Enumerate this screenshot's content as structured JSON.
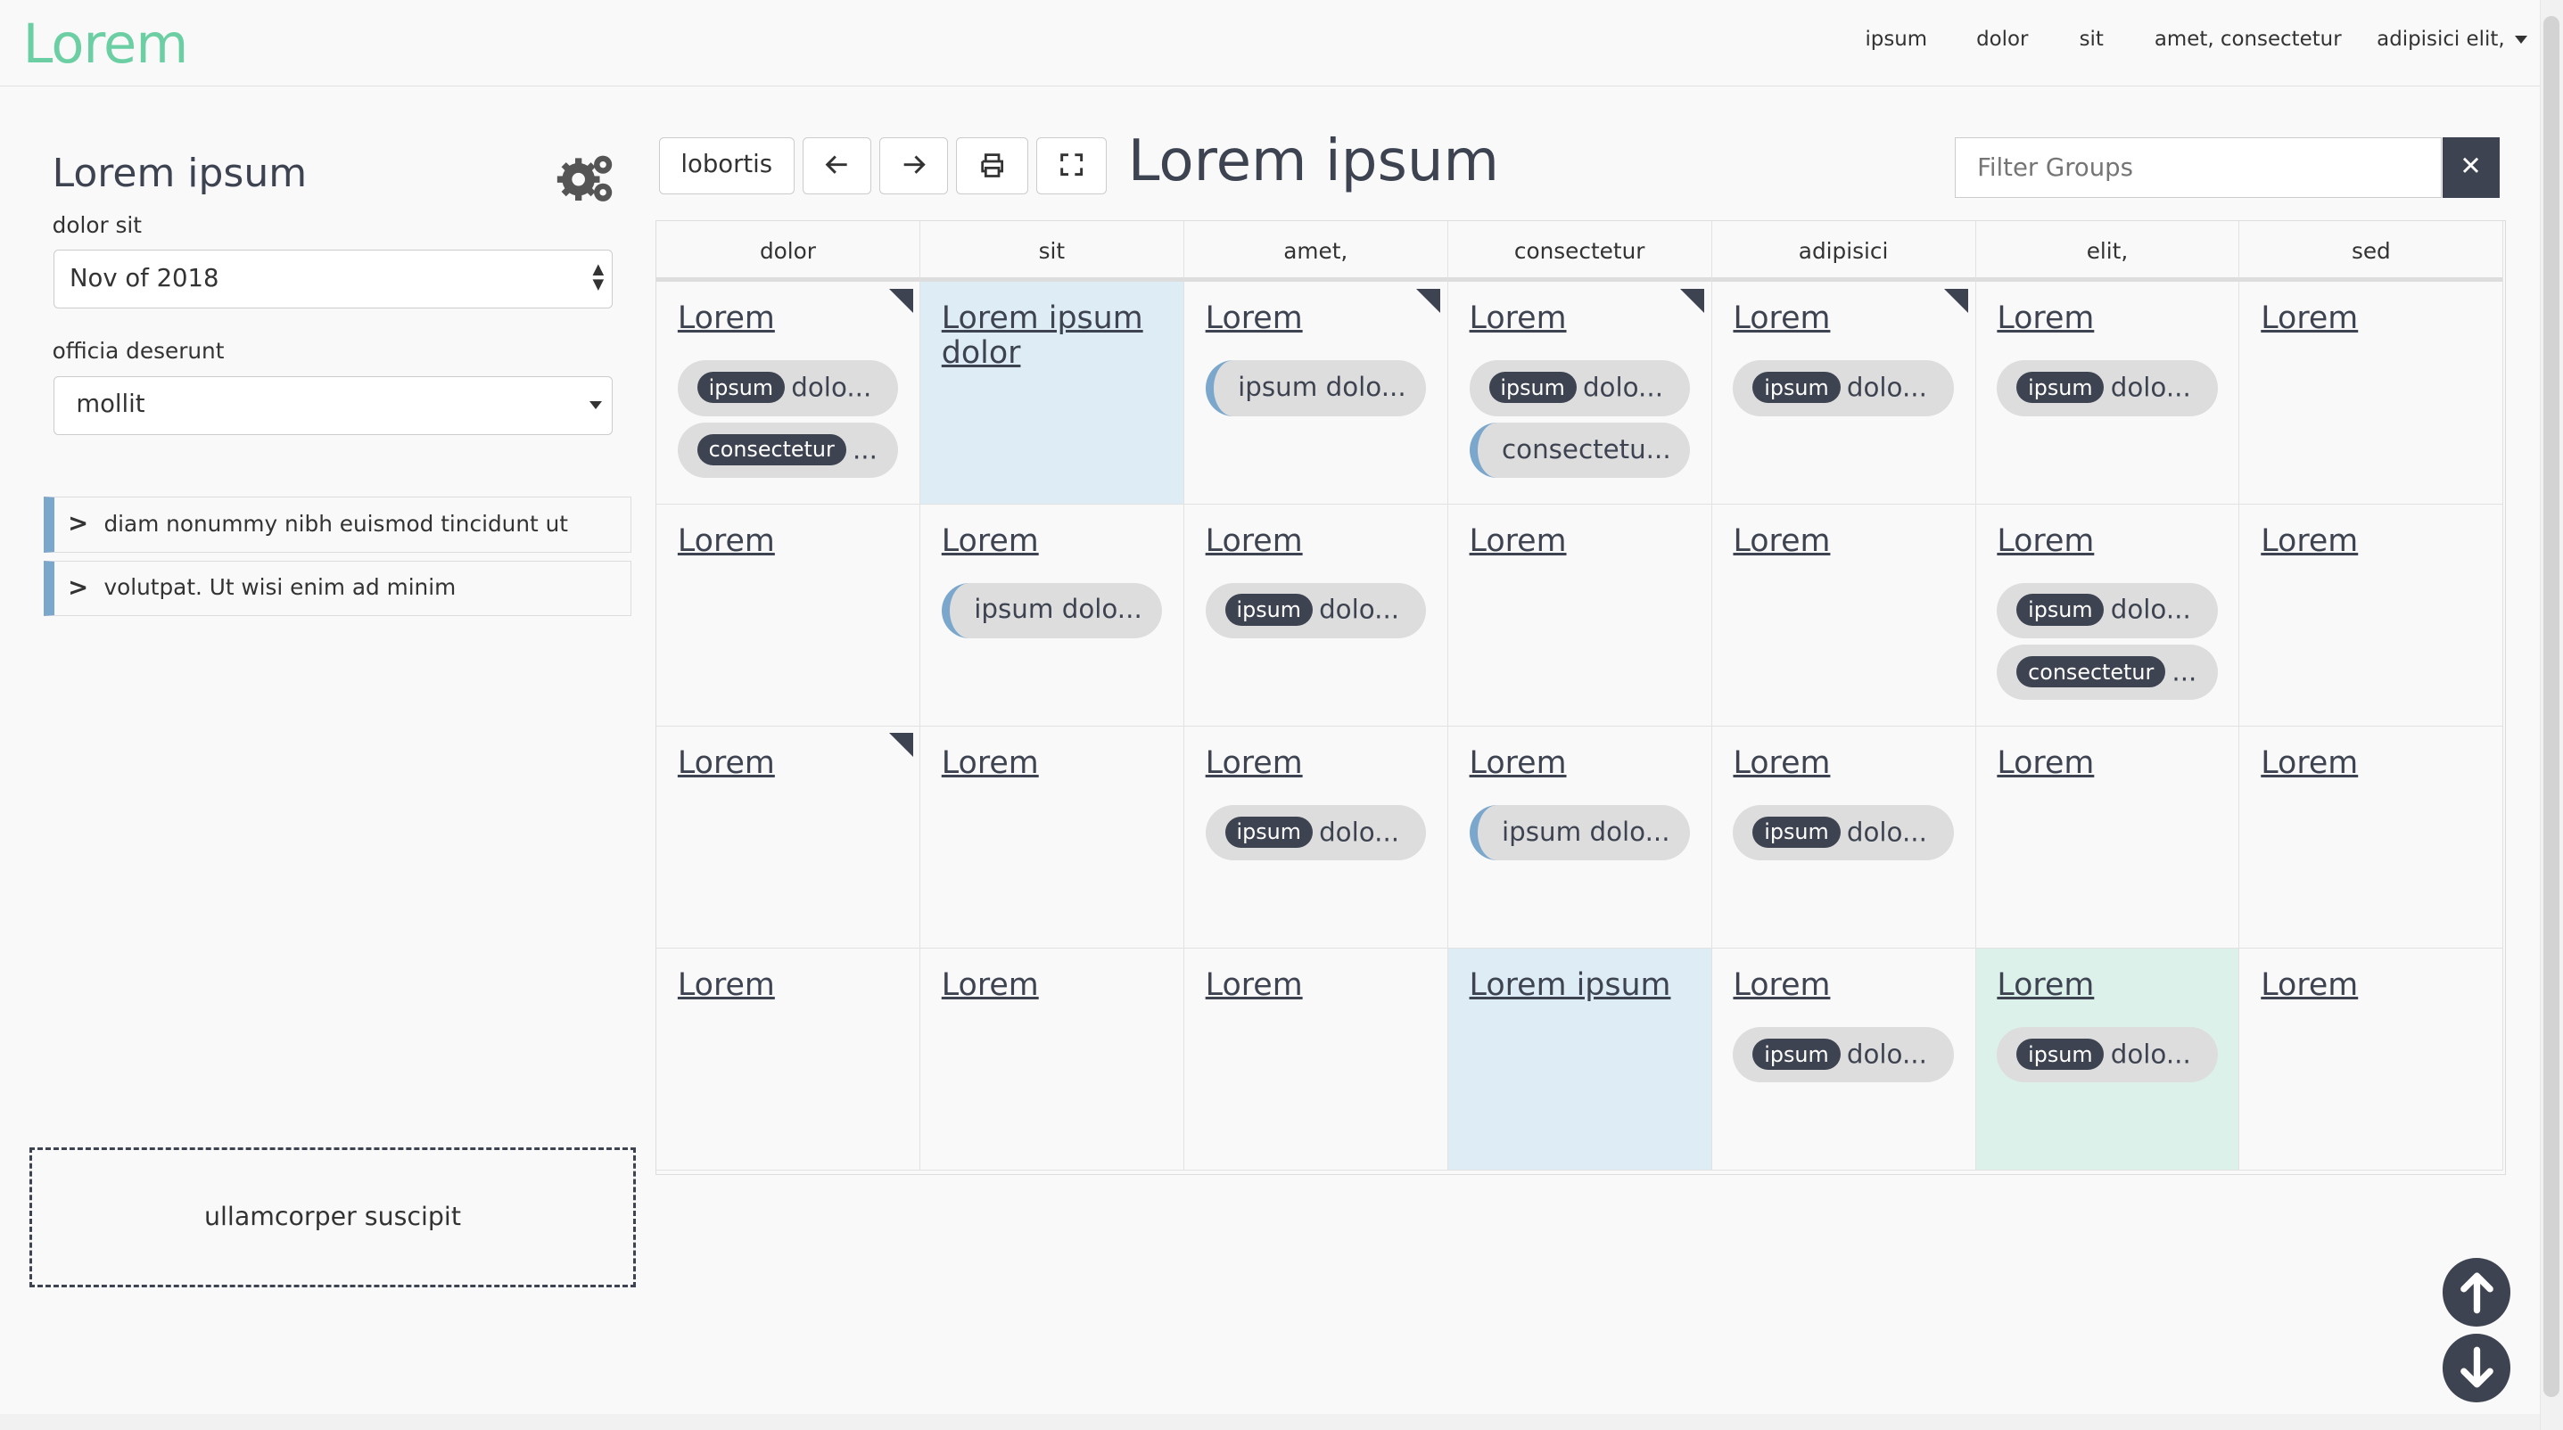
{
  "header": {
    "logo": "Lorem",
    "nav": [
      "ipsum",
      "dolor",
      "sit",
      "amet, consectetur",
      "adipisici elit,"
    ]
  },
  "sidebar": {
    "title": "Lorem ipsum",
    "field1_label": "dolor sit",
    "field1_value": "Nov of 2018",
    "field2_label": "officia deserunt",
    "field2_value": "mollit",
    "accordion": [
      "diam nonummy nibh euismod tincidunt ut",
      "volutpat. Ut wisi enim ad minim"
    ],
    "dropzone": "ullamcorper suscipit"
  },
  "toolbar": {
    "button_label": "lobortis",
    "title": "Lorem ipsum",
    "filter_placeholder": "Filter Groups",
    "clear_label": "✕"
  },
  "colors": {
    "accent": "#6ccfa4",
    "dark": "#3d4350",
    "bar": "#7ba7cd",
    "highlight_blue": "#ddecf5",
    "highlight_green": "#dcf1ea"
  },
  "grid": {
    "columns": [
      "dolor",
      "sit",
      "amet,",
      "consectetur",
      "adipisici",
      "elit,",
      "sed"
    ],
    "rows": [
      [
        {
          "title": "Lorem",
          "flag": true,
          "pills": [
            {
              "type": "badge",
              "badge": "ipsum",
              "text": "dolo..."
            },
            {
              "type": "badge",
              "badge": "consectetur",
              "text": "..."
            }
          ]
        },
        {
          "title": "Lorem ipsum dolor",
          "bg": "blue",
          "pills": []
        },
        {
          "title": "Lorem",
          "flag": true,
          "pills": [
            {
              "type": "bar",
              "text": "ipsum dolo..."
            }
          ]
        },
        {
          "title": "Lorem",
          "flag": true,
          "pills": [
            {
              "type": "badge",
              "badge": "ipsum",
              "text": "dolo..."
            },
            {
              "type": "bar",
              "text": "consectetu..."
            }
          ]
        },
        {
          "title": "Lorem",
          "flag": true,
          "pills": [
            {
              "type": "badge",
              "badge": "ipsum",
              "text": "dolo..."
            }
          ]
        },
        {
          "title": "Lorem",
          "pills": [
            {
              "type": "badge",
              "badge": "ipsum",
              "text": "dolo..."
            }
          ]
        },
        {
          "title": "Lorem",
          "pills": []
        }
      ],
      [
        {
          "title": "Lorem",
          "pills": []
        },
        {
          "title": "Lorem",
          "pills": [
            {
              "type": "bar",
              "text": "ipsum dolo..."
            }
          ]
        },
        {
          "title": "Lorem",
          "pills": [
            {
              "type": "badge",
              "badge": "ipsum",
              "text": "dolo..."
            }
          ]
        },
        {
          "title": "Lorem",
          "pills": []
        },
        {
          "title": "Lorem",
          "pills": []
        },
        {
          "title": "Lorem",
          "pills": [
            {
              "type": "badge",
              "badge": "ipsum",
              "text": "dolo..."
            },
            {
              "type": "badge",
              "badge": "consectetur",
              "text": "..."
            }
          ]
        },
        {
          "title": "Lorem",
          "pills": []
        }
      ],
      [
        {
          "title": "Lorem",
          "flag": true,
          "pills": []
        },
        {
          "title": "Lorem",
          "pills": []
        },
        {
          "title": "Lorem",
          "pills": [
            {
              "type": "badge",
              "badge": "ipsum",
              "text": "dolo..."
            }
          ]
        },
        {
          "title": "Lorem",
          "pills": [
            {
              "type": "bar",
              "text": "ipsum dolo..."
            }
          ]
        },
        {
          "title": "Lorem",
          "pills": [
            {
              "type": "badge",
              "badge": "ipsum",
              "text": "dolo..."
            }
          ]
        },
        {
          "title": "Lorem",
          "pills": []
        },
        {
          "title": "Lorem",
          "pills": []
        }
      ],
      [
        {
          "title": "Lorem",
          "pills": []
        },
        {
          "title": "Lorem",
          "pills": []
        },
        {
          "title": "Lorem",
          "pills": []
        },
        {
          "title": "Lorem ipsum",
          "bg": "blue",
          "pills": []
        },
        {
          "title": "Lorem",
          "pills": [
            {
              "type": "badge",
              "badge": "ipsum",
              "text": "dolo..."
            }
          ]
        },
        {
          "title": "Lorem",
          "bg": "green",
          "pills": [
            {
              "type": "badge",
              "badge": "ipsum",
              "text": "dolo..."
            }
          ]
        },
        {
          "title": "Lorem",
          "pills": []
        }
      ]
    ]
  }
}
